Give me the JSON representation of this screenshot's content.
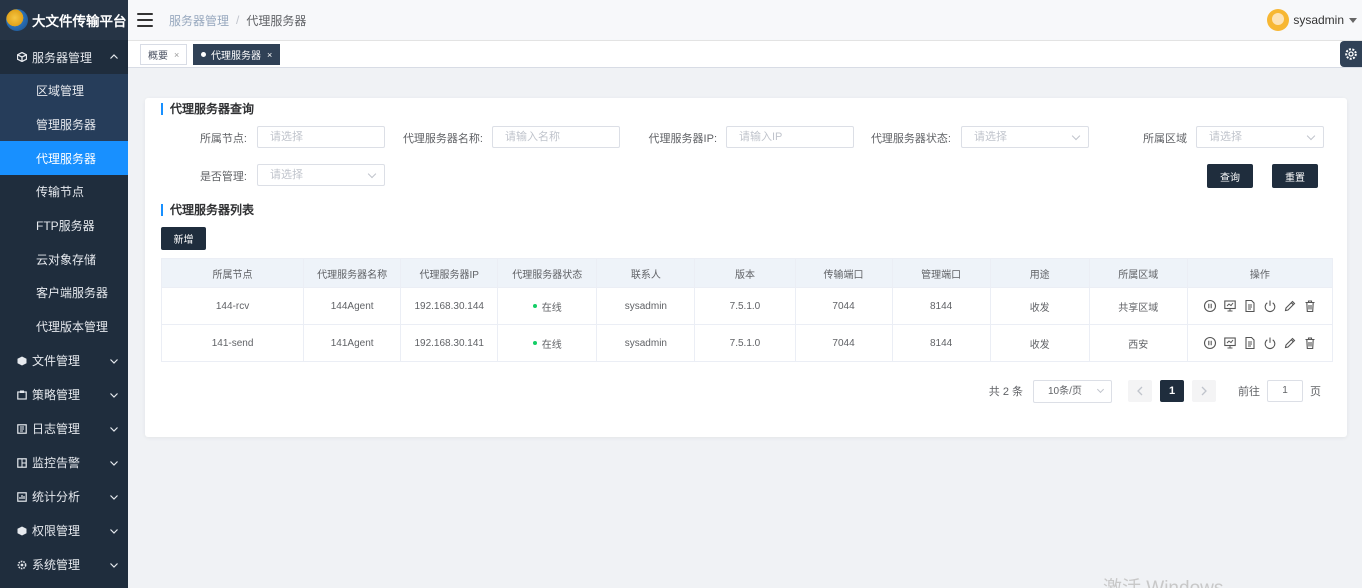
{
  "app": {
    "title": "大文件传输平台"
  },
  "sidebar": {
    "groups": [
      {
        "label": "服务器管理",
        "icon": "cube-icon",
        "expanded": true,
        "items": [
          {
            "label": "区域管理"
          },
          {
            "label": "管理服务器"
          },
          {
            "label": "代理服务器"
          },
          {
            "label": "传输节点"
          },
          {
            "label": "FTP服务器"
          },
          {
            "label": "云对象存储"
          },
          {
            "label": "客户端服务器"
          },
          {
            "label": "代理版本管理"
          }
        ]
      },
      {
        "label": "文件管理",
        "icon": "cube-icon"
      },
      {
        "label": "策略管理",
        "icon": "policy-icon"
      },
      {
        "label": "日志管理",
        "icon": "log-icon"
      },
      {
        "label": "监控告警",
        "icon": "monitor-icon"
      },
      {
        "label": "统计分析",
        "icon": "chart-icon"
      },
      {
        "label": "权限管理",
        "icon": "cube-icon"
      },
      {
        "label": "系统管理",
        "icon": "gear-icon"
      }
    ]
  },
  "header": {
    "breadcrumb": [
      "服务器管理",
      "代理服务器"
    ],
    "username": "sysadmin"
  },
  "tags": [
    {
      "label": "概要",
      "active": false
    },
    {
      "label": "代理服务器",
      "active": true
    }
  ],
  "query": {
    "title": "代理服务器查询",
    "fields": {
      "node": {
        "label": "所属节点:",
        "placeholder": "请选择"
      },
      "name": {
        "label": "代理服务器名称:",
        "placeholder": "请输入名称"
      },
      "ip": {
        "label": "代理服务器IP:",
        "placeholder": "请输入IP"
      },
      "status": {
        "label": "代理服务器状态:",
        "placeholder": "请选择"
      },
      "region": {
        "label": "所属区域",
        "placeholder": "请选择"
      },
      "managed": {
        "label": "是否管理:",
        "placeholder": "请选择"
      }
    },
    "search_label": "查询",
    "reset_label": "重置"
  },
  "list": {
    "title": "代理服务器列表",
    "add_label": "新增",
    "columns": [
      "所属节点",
      "代理服务器名称",
      "代理服务器IP",
      "代理服务器状态",
      "联系人",
      "版本",
      "传输端口",
      "管理端口",
      "用途",
      "所属区域",
      "操作"
    ],
    "rows": [
      {
        "node": "144-rcv",
        "name": "144Agent",
        "ip": "192.168.30.144",
        "status": "在线",
        "contact": "sysadmin",
        "version": "7.5.1.0",
        "transfer_port": "7044",
        "mgmt_port": "8144",
        "usage": "收发",
        "region": "共享区域"
      },
      {
        "node": "141-send",
        "name": "141Agent",
        "ip": "192.168.30.141",
        "status": "在线",
        "contact": "sysadmin",
        "version": "7.5.1.0",
        "transfer_port": "7044",
        "mgmt_port": "8144",
        "usage": "收发",
        "region": "西安"
      }
    ],
    "status_color": "#13ce66"
  },
  "pagination": {
    "total_text": "共 2 条",
    "page_size": "10条/页",
    "current_page": "1",
    "goto_label": "前往",
    "goto_value": "1",
    "page_suffix": "页"
  },
  "watermark": "激活 Windows",
  "colors": {
    "sidebar_bg": "#1f2d3d",
    "accent": "#1890ff",
    "dark_button": "#1f2d3d"
  }
}
